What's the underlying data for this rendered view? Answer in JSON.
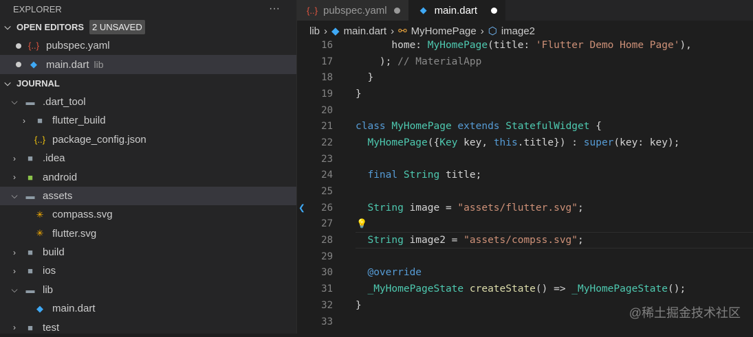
{
  "sidebar": {
    "title": "EXPLORER",
    "more": "···",
    "open_editors": {
      "label": "OPEN EDITORS",
      "badge": "2 UNSAVED",
      "items": [
        {
          "name": "pubspec.yaml",
          "desc": ""
        },
        {
          "name": "main.dart",
          "desc": "lib"
        }
      ]
    },
    "project": {
      "label": "JOURNAL"
    },
    "tree": [
      {
        "name": ".dart_tool",
        "depth": 1,
        "chev": "v",
        "icon": "folder-open"
      },
      {
        "name": "flutter_build",
        "depth": 2,
        "chev": ">",
        "icon": "folder"
      },
      {
        "name": "package_config.json",
        "depth": 2,
        "chev": "",
        "icon": "json"
      },
      {
        "name": ".idea",
        "depth": 1,
        "chev": ">",
        "icon": "folder"
      },
      {
        "name": "android",
        "depth": 1,
        "chev": ">",
        "icon": "folder-android"
      },
      {
        "name": "assets",
        "depth": 1,
        "chev": "v",
        "icon": "folder-open",
        "selected": true
      },
      {
        "name": "compass.svg",
        "depth": 2,
        "chev": "",
        "icon": "svg"
      },
      {
        "name": "flutter.svg",
        "depth": 2,
        "chev": "",
        "icon": "svg"
      },
      {
        "name": "build",
        "depth": 1,
        "chev": ">",
        "icon": "folder"
      },
      {
        "name": "ios",
        "depth": 1,
        "chev": ">",
        "icon": "folder"
      },
      {
        "name": "lib",
        "depth": 1,
        "chev": "v",
        "icon": "folder-open"
      },
      {
        "name": "main.dart",
        "depth": 2,
        "chev": "",
        "icon": "dart"
      },
      {
        "name": "test",
        "depth": 1,
        "chev": ">",
        "icon": "folder"
      }
    ]
  },
  "tabs": [
    {
      "label": "pubspec.yaml",
      "active": false
    },
    {
      "label": "main.dart",
      "active": true
    }
  ],
  "breadcrumb": [
    "lib",
    "main.dart",
    "MyHomePage",
    "image2"
  ],
  "code": [
    {
      "n": "16",
      "t": [
        [
          "      home: ",
          "tx"
        ],
        [
          "MyHomePage",
          "ty"
        ],
        [
          "(title: ",
          "tx"
        ],
        [
          "'Flutter Demo Home Page'",
          "st"
        ],
        [
          "),",
          "tx"
        ]
      ]
    },
    {
      "n": "17",
      "t": [
        [
          "    ); ",
          "tx"
        ],
        [
          "// MaterialApp",
          "gy"
        ]
      ]
    },
    {
      "n": "18",
      "t": [
        [
          "  }",
          "tx"
        ]
      ]
    },
    {
      "n": "19",
      "t": [
        [
          "}",
          "tx"
        ]
      ]
    },
    {
      "n": "20",
      "t": []
    },
    {
      "n": "21",
      "t": [
        [
          "class ",
          "kw"
        ],
        [
          "MyHomePage ",
          "ty"
        ],
        [
          "extends ",
          "kw"
        ],
        [
          "StatefulWidget ",
          "ty"
        ],
        [
          "{",
          "tx"
        ]
      ]
    },
    {
      "n": "22",
      "t": [
        [
          "  MyHomePage",
          "ty"
        ],
        [
          "({",
          "tx"
        ],
        [
          "Key ",
          "ty"
        ],
        [
          "key, ",
          "tx"
        ],
        [
          "this",
          "kw"
        ],
        [
          ".title}) : ",
          "tx"
        ],
        [
          "super",
          "kw"
        ],
        [
          "(key: key);",
          "tx"
        ]
      ]
    },
    {
      "n": "23",
      "t": []
    },
    {
      "n": "24",
      "t": [
        [
          "  final ",
          "kw"
        ],
        [
          "String ",
          "ty"
        ],
        [
          "title;",
          "tx"
        ]
      ]
    },
    {
      "n": "25",
      "t": []
    },
    {
      "n": "26",
      "t": [
        [
          "  String ",
          "ty"
        ],
        [
          "image = ",
          "tx"
        ],
        [
          "\"assets/flutter.svg\"",
          "st"
        ],
        [
          ";",
          "tx"
        ]
      ]
    },
    {
      "n": "27",
      "t": []
    },
    {
      "n": "28",
      "t": [
        [
          "  String ",
          "ty"
        ],
        [
          "image2 = ",
          "tx"
        ],
        [
          "\"assets/compss.svg\"",
          "st"
        ],
        [
          ";",
          "tx"
        ]
      ]
    },
    {
      "n": "29",
      "t": []
    },
    {
      "n": "30",
      "t": [
        [
          "  @override",
          "kw"
        ]
      ]
    },
    {
      "n": "31",
      "t": [
        [
          "  _MyHomePageState ",
          "ty"
        ],
        [
          "createState",
          "fn"
        ],
        [
          "() => ",
          "tx"
        ],
        [
          "_MyHomePageState",
          "ty"
        ],
        [
          "();",
          "tx"
        ]
      ]
    },
    {
      "n": "32",
      "t": [
        [
          "}",
          "tx"
        ]
      ]
    },
    {
      "n": "33",
      "t": []
    }
  ],
  "watermark": "@稀土掘金技术社区"
}
